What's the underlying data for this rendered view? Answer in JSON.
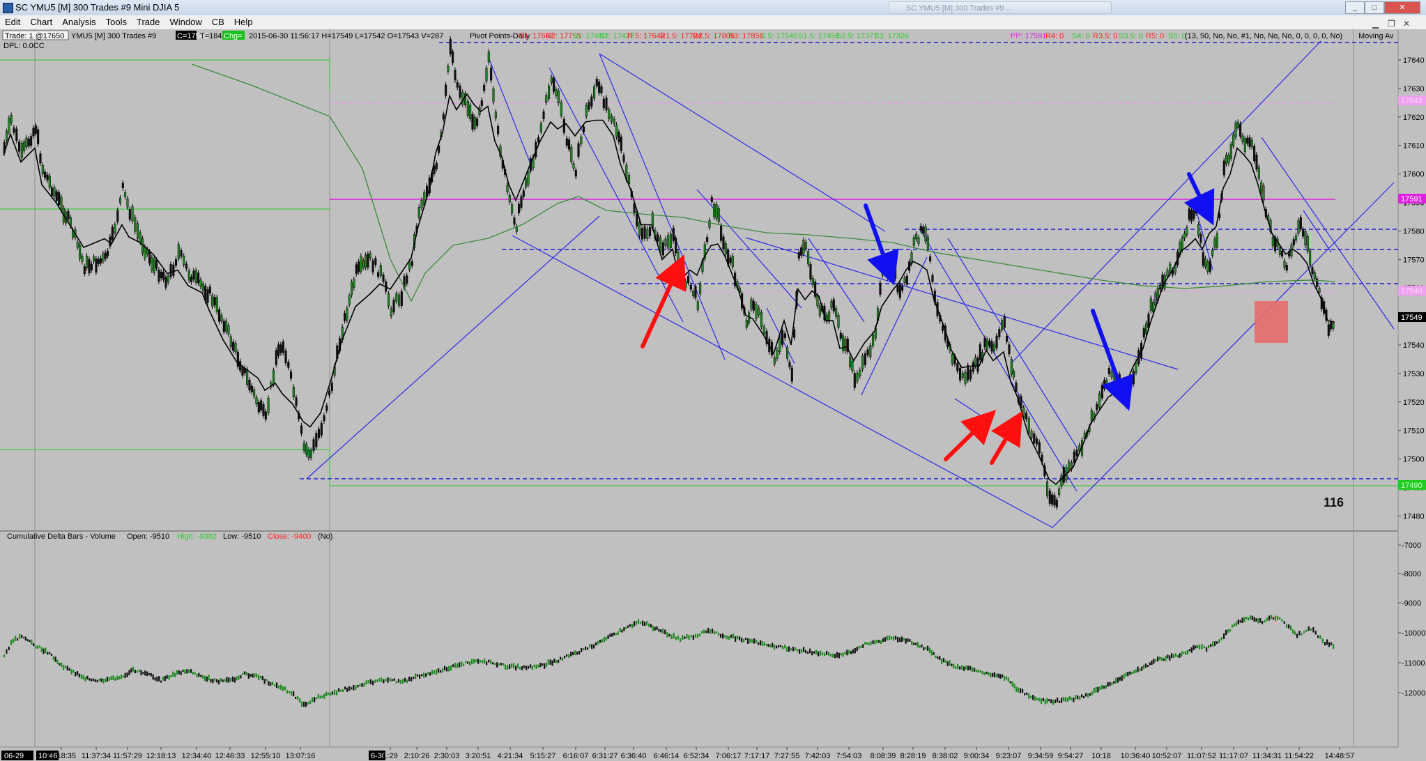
{
  "window": {
    "title": "SC YMU5 [M]  300 Trades  #9  Mini DJIA 5",
    "ghost_tab": "SC YMU5 [M] 300 Trades  #9 ...",
    "buttons": [
      "_",
      "□",
      "✕"
    ]
  },
  "menu": [
    "Edit",
    "Chart",
    "Analysis",
    "Tools",
    "Trade",
    "Window",
    "CB",
    "Help"
  ],
  "header": {
    "trade_box": "Trade: 1 @17650",
    "symbol_info": "YMU5 [M]  300 Trades  #9",
    "current_box": "C=17549",
    "stats": "T=184",
    "chg_box": "Chg=",
    "ohlc": "2015-06-30 11:56:17 H=17549 L=17542 O=17543 V=287",
    "study_name": "Pivot Points-Daily",
    "pivots": [
      {
        "text": "R1: 17692",
        "color": "#ff2020"
      },
      {
        "text": "R2: 17755",
        "color": "#ff2020"
      },
      {
        "text": "S1: 17490",
        "color": "#2ecc2e"
      },
      {
        "text": "S2: 17427",
        "color": "#2ecc2e"
      },
      {
        "text": "R.5: 17642",
        "color": "#ff2020"
      },
      {
        "text": "R1.5: 17724",
        "color": "#ff2020"
      },
      {
        "text": "R2.5: 17805",
        "color": "#ff2020"
      },
      {
        "text": "R3: 17856",
        "color": "#ff2020"
      },
      {
        "text": "S.5: 17540",
        "color": "#2ecc2e"
      },
      {
        "text": "S1.5: 17458",
        "color": "#2ecc2e"
      },
      {
        "text": "S2.5: 17377",
        "color": "#2ecc2e"
      },
      {
        "text": "S3: 17326",
        "color": "#2ecc2e"
      },
      {
        "text": "PP: 17591",
        "color": "#e020e0"
      },
      {
        "text": "R4: 0",
        "color": "#ff2020"
      },
      {
        "text": "S4: 0",
        "color": "#2ecc2e"
      },
      {
        "text": "R3.5: 0",
        "color": "#ff2020"
      },
      {
        "text": "S3.5: 0",
        "color": "#2ecc2e"
      },
      {
        "text": "R5: 0",
        "color": "#ff2020"
      },
      {
        "text": "S5: 0",
        "color": "#2ecc2e"
      }
    ],
    "ma_params": "(13, 50, No, No, #1, No, No, No, 0, 0, 0, 0, No)",
    "ma_name": "Moving Av",
    "dpl": "DPL: 0.0CC"
  },
  "price_axis": {
    "labels": [
      "17640",
      "17630",
      "17620",
      "17610",
      "17600",
      "17590",
      "17580",
      "17570",
      "17560",
      "17550",
      "17540",
      "17530",
      "17520",
      "17510",
      "17500",
      "17490",
      "17480"
    ],
    "current_price_tag": "17549",
    "pp_tag": "17591",
    "s1_tag": "17490",
    "r5_tag": "17642",
    "s5_tag": "17540"
  },
  "annotation_count": "116",
  "lower_pane": {
    "title": "Cumulative Delta Bars - Volume",
    "open": "Open: -9510",
    "high": "High: -9382",
    "low": "Low: -9510",
    "close": "Close: -9400",
    "extra": "(No)",
    "axis_labels": [
      "-7000",
      "-8000",
      "-9000",
      "-10000",
      "-11000",
      "-12000"
    ]
  },
  "time_axis": {
    "date_tags": [
      "06-29",
      "6-30"
    ],
    "start_time": "10:46",
    "labels": [
      "11:18:35",
      "11:37:34",
      "11:57:29",
      "12:18:13",
      "12:34:40",
      "12:46:33",
      "12:55:10",
      "13:07:16",
      "1:29",
      "2:10:26",
      "2:30:03",
      "3:20:51",
      "4:21:34",
      "5:15:27",
      "6:16:07",
      "6:31:27",
      "6:36:40",
      "6:46:14",
      "6:52:34",
      "7:06:17",
      "7:17:17",
      "7:27:55",
      "7:42:03",
      "7:54:03",
      "8:08:39",
      "8:28:19",
      "8:38:02",
      "9:00:34",
      "9:23:07",
      "9:34:59",
      "9:54:27",
      "10:18",
      "10:36:40",
      "10:52:07",
      "11:07:52",
      "11:17:07",
      "11:34:31",
      "11:54:22",
      "14:48:57"
    ]
  },
  "colors": {
    "background": "#c0c0c0",
    "trendline": "#2a2ae6",
    "pivot_pp": "#e020e0",
    "s1_line": "#2ecc2e",
    "ma_fast": "#000000",
    "ma_slow": "#3a8a3a",
    "arrow_red": "#ff1010",
    "arrow_blue": "#1010f0",
    "zone": "#e86a6a"
  }
}
